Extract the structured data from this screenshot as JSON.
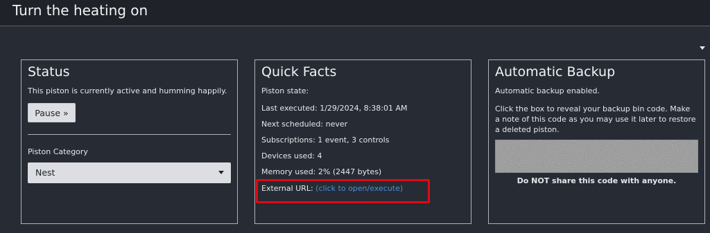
{
  "header": {
    "title": "Turn the heating on"
  },
  "status": {
    "title": "Status",
    "text": "This piston is currently active and humming happily.",
    "pause_label": "Pause »",
    "category_label": "Piston Category",
    "category_value": "Nest"
  },
  "facts": {
    "title": "Quick Facts",
    "state": "Piston state:",
    "last_executed": "Last executed: 1/29/2024, 8:38:01 AM",
    "next_scheduled": "Next scheduled: never",
    "subscriptions": "Subscriptions: 1 event, 3 controls",
    "devices": "Devices used: 4",
    "memory": "Memory used: 2% (2447 bytes)",
    "external_url_label": "External URL:",
    "external_url_link": "(click to open/execute)"
  },
  "backup": {
    "title": "Automatic Backup",
    "enabled_text": "Automatic backup enabled.",
    "instructions": "Click the box to reveal your backup bin code. Make a note of this code as you may use it later to restore a deleted piston.",
    "warning": "Do NOT share this code with anyone."
  },
  "colors": {
    "background": "#272b33",
    "topbar": "#1f2228",
    "link": "#4d8fd6",
    "highlight": "#e00a16"
  }
}
